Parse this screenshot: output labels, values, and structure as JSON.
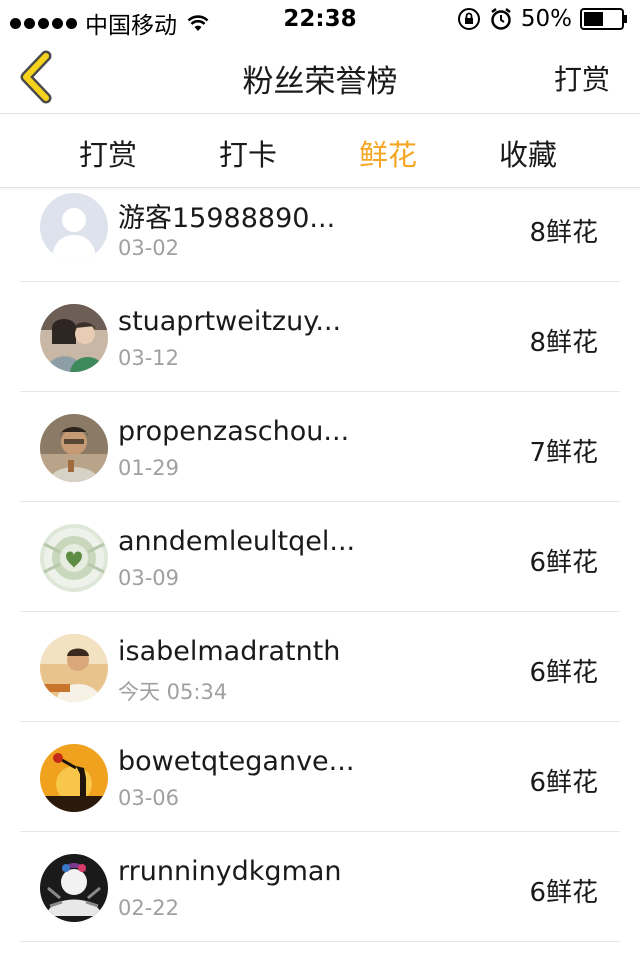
{
  "status": {
    "carrier": "中国移动",
    "time": "22:38",
    "battery": "50%"
  },
  "nav": {
    "title": "粉丝荣誉榜",
    "right_label": "打赏",
    "accent": "#f5a623"
  },
  "tabs": [
    {
      "label": "打赏",
      "active": false
    },
    {
      "label": "打卡",
      "active": false
    },
    {
      "label": "鲜花",
      "active": true
    },
    {
      "label": "收藏",
      "active": false
    }
  ],
  "fans": [
    {
      "name": "游客15988890...",
      "date": "03-02",
      "amount": "8鲜花",
      "avatar": "default-avatar"
    },
    {
      "name": "stuaprtweitzuy...",
      "date": "03-12",
      "amount": "8鲜花",
      "avatar": "couple-photo"
    },
    {
      "name": "propenzaschou...",
      "date": "01-29",
      "amount": "7鲜花",
      "avatar": "man-photo"
    },
    {
      "name": "anndemleultqel...",
      "date": "03-09",
      "amount": "6鲜花",
      "avatar": "flower-photo"
    },
    {
      "name": "isabelmadratnth",
      "date": "今天 05:34",
      "amount": "6鲜花",
      "avatar": "boy-photo"
    },
    {
      "name": "bowetqteganve...",
      "date": "03-06",
      "amount": "6鲜花",
      "avatar": "sunset-photo"
    },
    {
      "name": "rrunninydkgman",
      "date": "02-22",
      "amount": "6鲜花",
      "avatar": "bw-photo"
    }
  ]
}
